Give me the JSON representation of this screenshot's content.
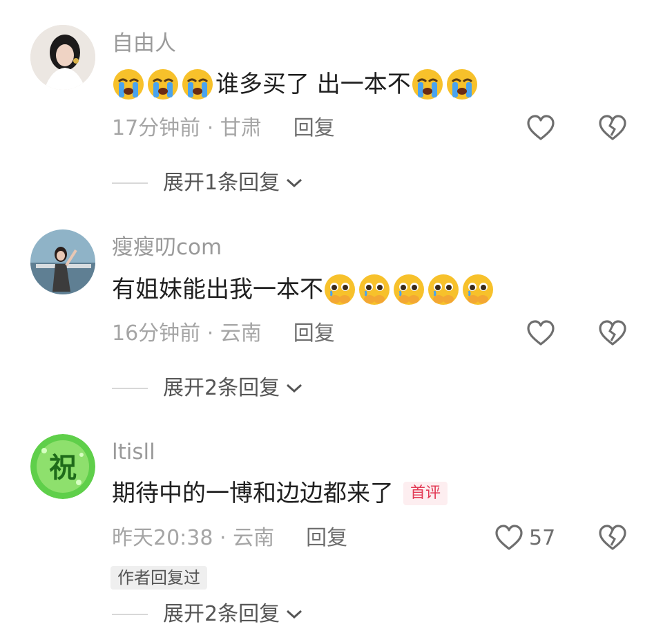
{
  "comments": [
    {
      "username": "自由人",
      "text_before": "谁多买了 出一本不",
      "meta": "17分钟前 · 甘肃",
      "reply_label": "回复",
      "like_count": "",
      "expand_label": "展开1条回复",
      "avatar_icon": "portrait-woman-avatar",
      "emoji_lead": "loudly-crying-face",
      "emoji_trail": "loudly-crying-face"
    },
    {
      "username": "瘦瘦叨com",
      "text_before": "有姐妹能出我一本不",
      "meta": "16分钟前 · 云南",
      "reply_label": "回复",
      "like_count": "",
      "expand_label": "展开2条回复",
      "avatar_icon": "portrait-seaside-avatar",
      "emoji_trail": "holding-back-tears-face"
    },
    {
      "username": "ltisll",
      "text_before": "期待中的一博和边边都来了",
      "first_badge": "首评",
      "meta": "昨天20:38 · 云南",
      "reply_label": "回复",
      "like_count": "57",
      "author_badge": "作者回复过",
      "expand_label": "展开2条回复",
      "avatar_icon": "green-blessing-avatar",
      "avatar_glyph": "祝"
    }
  ],
  "colors": {
    "username": "#9a9a9a",
    "meta": "#a5a5a5",
    "badge_first_bg": "#fdeef0",
    "badge_first_text": "#e23a55"
  }
}
